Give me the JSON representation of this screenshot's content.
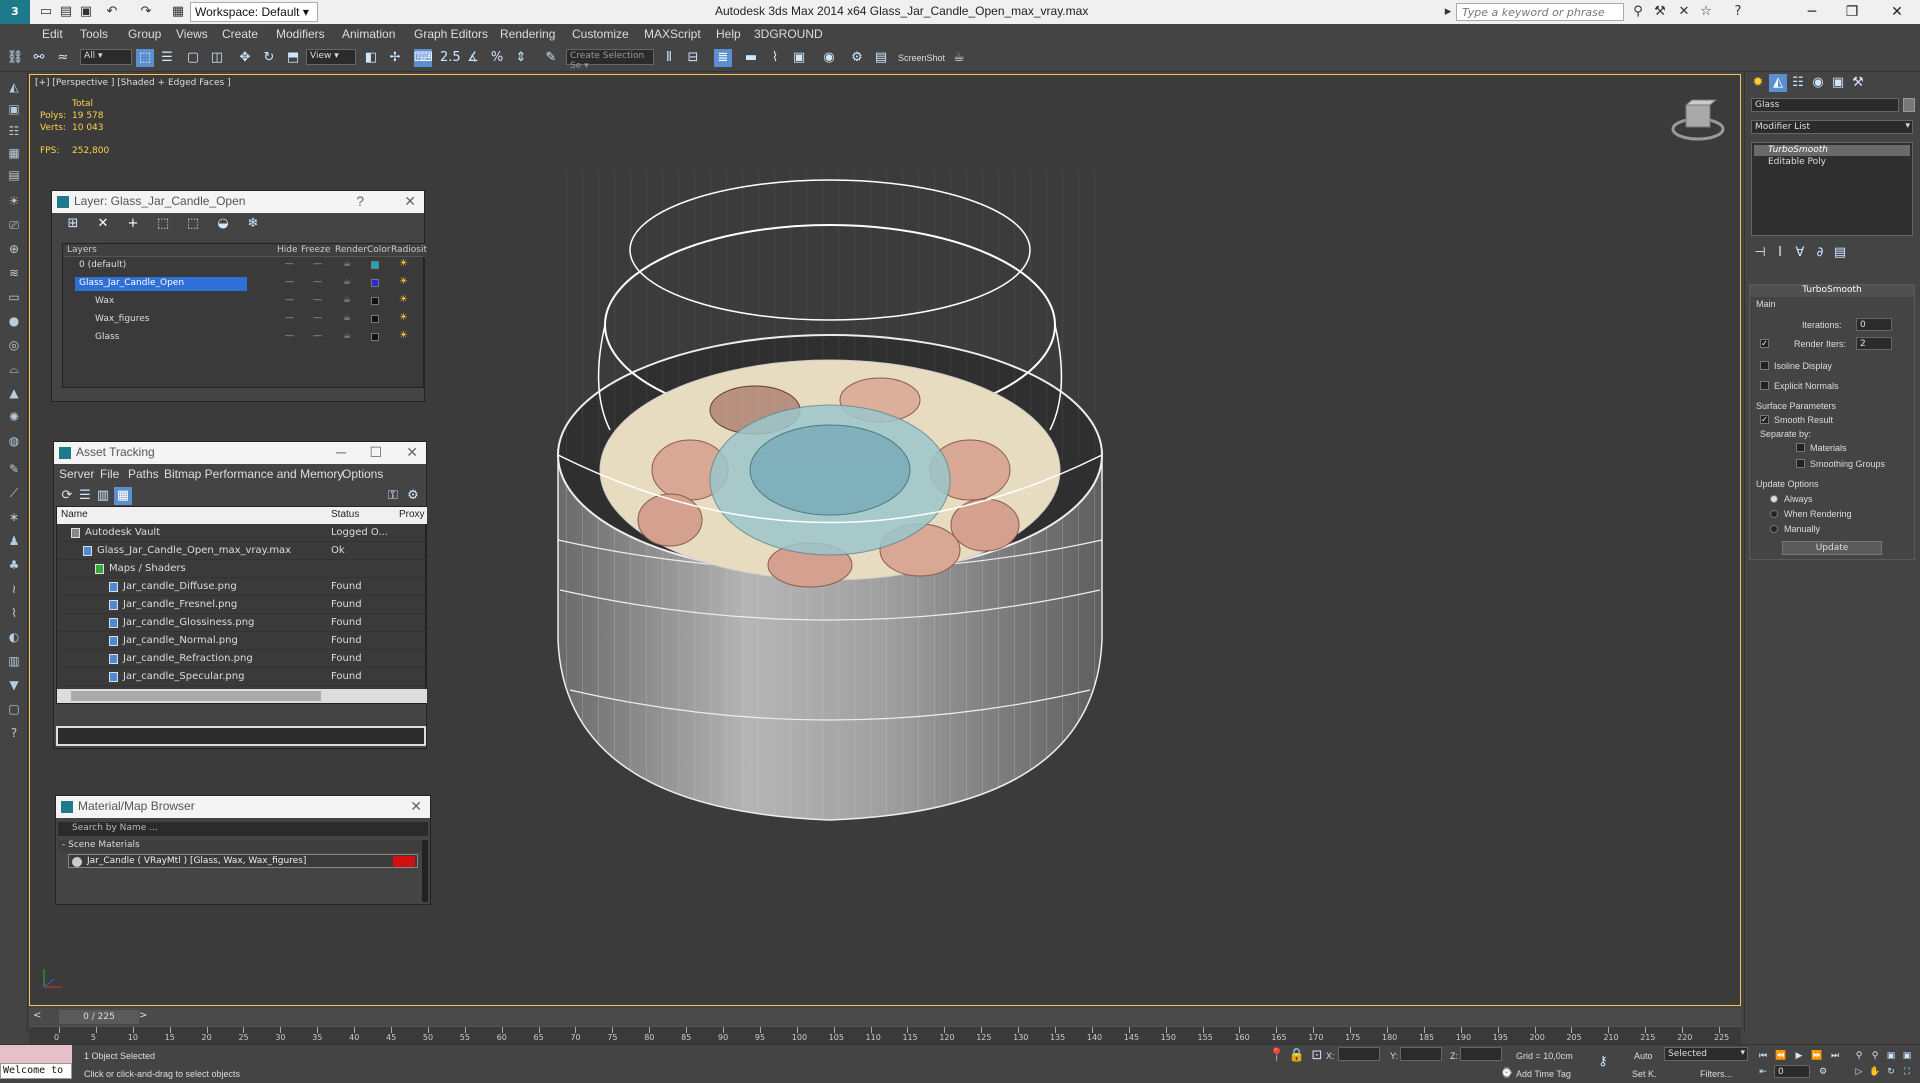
{
  "titlebar": {
    "workspace": "Workspace: Default",
    "title": "Autodesk 3ds Max  2014 x64      Glass_Jar_Candle_Open_max_vray.max",
    "search_placeholder": "Type a keyword or phrase"
  },
  "menu": [
    "Edit",
    "Tools",
    "Group",
    "Views",
    "Create",
    "Modifiers",
    "Animation",
    "Graph Editors",
    "Rendering",
    "Customize",
    "MAXScript",
    "Help",
    "3DGROUND"
  ],
  "toolbar": {
    "filter": "All",
    "ref_coord": "View",
    "selection_set": "Create Selection Se",
    "screenshot": "ScreenShot"
  },
  "viewport": {
    "label": "[+] [Perspective ] [Shaded + Edged Faces ]",
    "stats": {
      "total_label": "Total",
      "polys_label": "Polys:",
      "polys": "19 578",
      "verts_label": "Verts:",
      "verts": "10 043",
      "fps_label": "FPS:",
      "fps": "252,800"
    }
  },
  "layer_panel": {
    "title": "Layer: Glass_Jar_Candle_Open",
    "columns": [
      "Layers",
      "Hide",
      "Freeze",
      "Render",
      "Color",
      "Radiosit"
    ],
    "rows": [
      {
        "name": "0 (default)",
        "selected": false,
        "color": "#1aa8b8"
      },
      {
        "name": "Glass_Jar_Candle_Open",
        "selected": true,
        "color": "#2a2ad8"
      },
      {
        "name": "Wax",
        "selected": false,
        "color": "#111111"
      },
      {
        "name": "Wax_figures",
        "selected": false,
        "color": "#111111"
      },
      {
        "name": "Glass",
        "selected": false,
        "color": "#111111"
      }
    ]
  },
  "asset_panel": {
    "title": "Asset Tracking",
    "menu": [
      "Server",
      "File",
      "Paths",
      "Bitmap Performance and Memory",
      "Options"
    ],
    "columns": [
      "Name",
      "Status",
      "Proxy"
    ],
    "rows": [
      {
        "name": "Autodesk Vault",
        "status": "Logged O..."
      },
      {
        "name": "Glass_Jar_Candle_Open_max_vray.max",
        "status": "Ok"
      },
      {
        "name": "Maps / Shaders",
        "status": ""
      },
      {
        "name": "Jar_candle_Diffuse.png",
        "status": "Found"
      },
      {
        "name": "Jar_candle_Fresnel.png",
        "status": "Found"
      },
      {
        "name": "Jar_candle_Glossiness.png",
        "status": "Found"
      },
      {
        "name": "Jar_candle_Normal.png",
        "status": "Found"
      },
      {
        "name": "Jar_candle_Refraction.png",
        "status": "Found"
      },
      {
        "name": "Jar_candle_Specular.png",
        "status": "Found"
      }
    ]
  },
  "material_panel": {
    "title": "Material/Map Browser",
    "search_placeholder": "Search by Name ...",
    "group": "- Scene Materials",
    "item": "Jar_Candle  ( VRayMtl )  [Glass, Wax, Wax_figures]"
  },
  "command_panel": {
    "object_name": "Glass",
    "modifier_list": "Modifier List",
    "stack": [
      "TurboSmooth",
      "Editable Poly"
    ],
    "turbosmooth": {
      "title": "TurboSmooth",
      "main": "Main",
      "iterations_label": "Iterations:",
      "iterations": "0",
      "render_iters_label": "Render Iters:",
      "render_iters": "2",
      "render_iters_checked": true,
      "isoline": "Isoline Display",
      "explicit_normals": "Explicit Normals",
      "surface_params": "Surface Parameters",
      "smooth_result": "Smooth Result",
      "separate_by": "Separate by:",
      "materials": "Materials",
      "smoothing_groups": "Smoothing Groups",
      "update_options": "Update Options",
      "always": "Always",
      "when_rendering": "When Rendering",
      "manually": "Manually",
      "update_btn": "Update"
    }
  },
  "timeline": {
    "frame": "0 / 225",
    "ticks": [
      "0",
      "5",
      "10",
      "15",
      "20",
      "25",
      "30",
      "35",
      "40",
      "45",
      "50",
      "55",
      "60",
      "65",
      "70",
      "75",
      "80",
      "85",
      "90",
      "95",
      "100",
      "105",
      "110",
      "115",
      "120",
      "125",
      "130",
      "135",
      "140",
      "145",
      "150",
      "155",
      "160",
      "165",
      "170",
      "175",
      "180",
      "185",
      "190",
      "195",
      "200",
      "205",
      "210",
      "215",
      "220",
      "225"
    ]
  },
  "status": {
    "maxscript": "Welcome to",
    "selection": "1 Object Selected",
    "prompt": "Click or click-and-drag to select objects",
    "x_label": "X:",
    "y_label": "Y:",
    "z_label": "Z:",
    "grid": "Grid = 10,0cm",
    "auto": "Auto",
    "selected": "Selected",
    "set_k": "Set K.",
    "filters": "Filters...",
    "add_time_tag": "Add Time Tag",
    "frame_field": "0"
  }
}
